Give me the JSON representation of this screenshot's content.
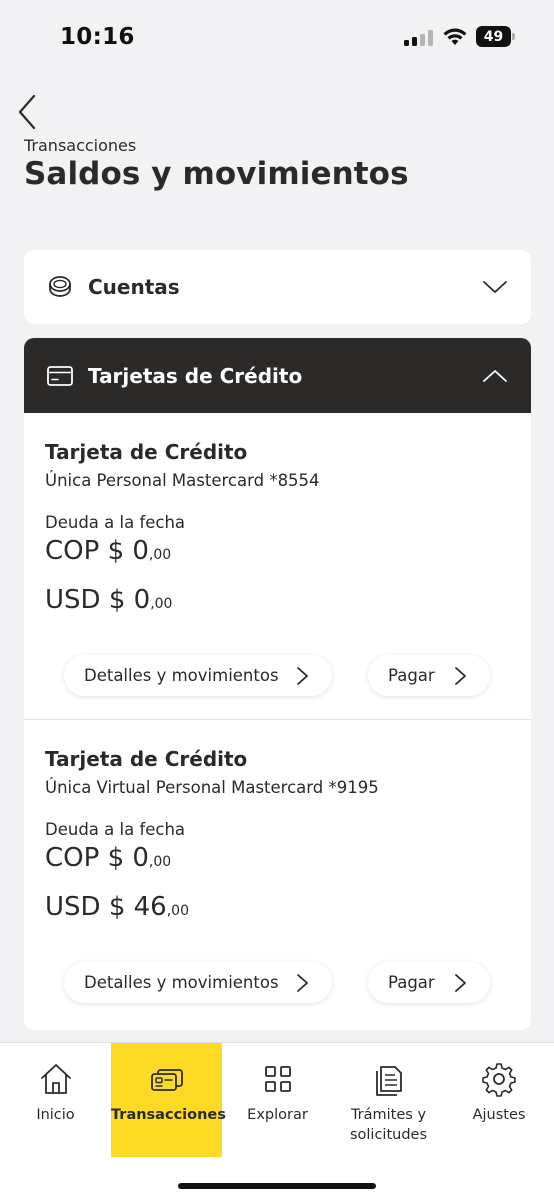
{
  "status_bar": {
    "time": "10:16",
    "battery": "49"
  },
  "header": {
    "overline": "Transacciones",
    "title": "Saldos y movimientos"
  },
  "accounts_section": {
    "label": "Cuentas",
    "icon": "coins-icon",
    "expanded": false
  },
  "cards_section": {
    "label": "Tarjetas de Crédito",
    "icon": "credit-card-icon",
    "expanded": true,
    "items": [
      {
        "title": "Tarjeta de Crédito",
        "subtitle": "Única Personal Mastercard *8554",
        "debt_label": "Deuda a la fecha",
        "cop_prefix": "COP $ ",
        "cop_value": "0",
        "cop_cents": ",00",
        "usd_prefix": "USD $ ",
        "usd_value": "0",
        "usd_cents": ",00",
        "details_button": "Detalles y movimientos",
        "pay_button": "Pagar"
      },
      {
        "title": "Tarjeta de Crédito",
        "subtitle": "Única Virtual Personal Mastercard *9195",
        "debt_label": "Deuda a la fecha",
        "cop_prefix": "COP $ ",
        "cop_value": "0",
        "cop_cents": ",00",
        "usd_prefix": "USD $ ",
        "usd_value": "46",
        "usd_cents": ",00",
        "details_button": "Detalles y movimientos",
        "pay_button": "Pagar"
      }
    ]
  },
  "bottom_nav": {
    "active_color": "#fdda24",
    "items": [
      {
        "label": "Inicio",
        "icon": "home-icon"
      },
      {
        "label": "Transacciones",
        "icon": "cards-icon",
        "active": true
      },
      {
        "label": "Explorar",
        "icon": "grid-icon"
      },
      {
        "label": "Trámites y solicitudes",
        "icon": "documents-icon"
      },
      {
        "label": "Ajustes",
        "icon": "gear-icon"
      }
    ]
  },
  "colors": {
    "background": "#f2f2f4",
    "dark": "#2c2a29",
    "accent": "#fdda24"
  }
}
